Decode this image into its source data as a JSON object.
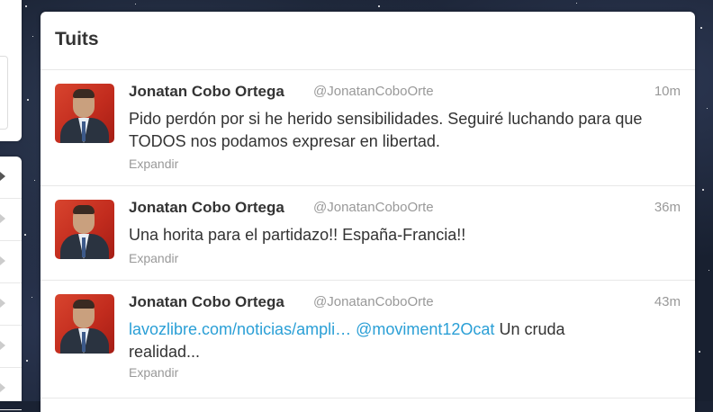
{
  "panel": {
    "title": "Tuits"
  },
  "tweets": [
    {
      "name": "Jonatan Cobo Ortega",
      "handle": "@JonatanCoboOrte",
      "time": "10m",
      "text": "Pido perdón por si he herido sensibilidades. Seguiré luchando para que TODOS nos podamos expresar en libertad.",
      "expand": "Expandir"
    },
    {
      "name": "Jonatan Cobo Ortega",
      "handle": "@JonatanCoboOrte",
      "time": "36m",
      "text": "Una horita para el partidazo!! España-Francia!!",
      "expand": "Expandir"
    },
    {
      "name": "Jonatan Cobo Ortega",
      "handle": "@JonatanCoboOrte",
      "time": "43m",
      "link1": "lavozlibre.com/noticias/ampli…",
      "link2": "@moviment12Ocat",
      "text": "Un cruda realidad...",
      "expand": "Expandir"
    }
  ],
  "colors": {
    "link": "#2a9fd6",
    "avatar_bg": "#c22c1e"
  },
  "icons": [
    "chevron-right-icon"
  ]
}
